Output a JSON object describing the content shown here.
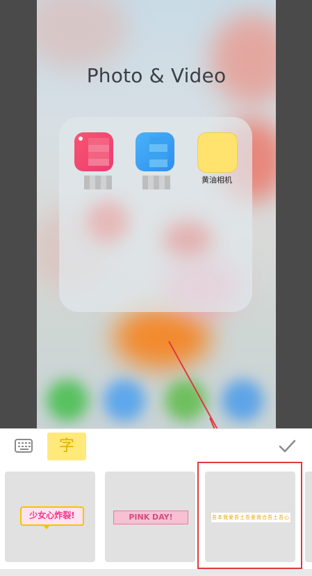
{
  "screen": {
    "title": "Photo & Video",
    "folder_apps": [
      {
        "name": "pink-app",
        "label": "",
        "color": "#f04a6a"
      },
      {
        "name": "blue-app",
        "label": "",
        "color": "#3a9cf0"
      },
      {
        "name": "yellow-app",
        "label": "黄油相机",
        "color": "#ffe36e"
      }
    ]
  },
  "toolbar": {
    "keyboard_icon": "keyboard-icon",
    "text_tab_label": "字",
    "confirm_icon": "checkmark-icon"
  },
  "stickers": [
    {
      "label": "少女心炸裂!"
    },
    {
      "label": "PINK DAY!"
    },
    {
      "label": "吾本我爱吾土吾爱我合吾土吾心"
    }
  ],
  "colors": {
    "highlight": "#e0383b",
    "arrow": "#e0383b",
    "text_tab_bg": "#ffe97a"
  }
}
